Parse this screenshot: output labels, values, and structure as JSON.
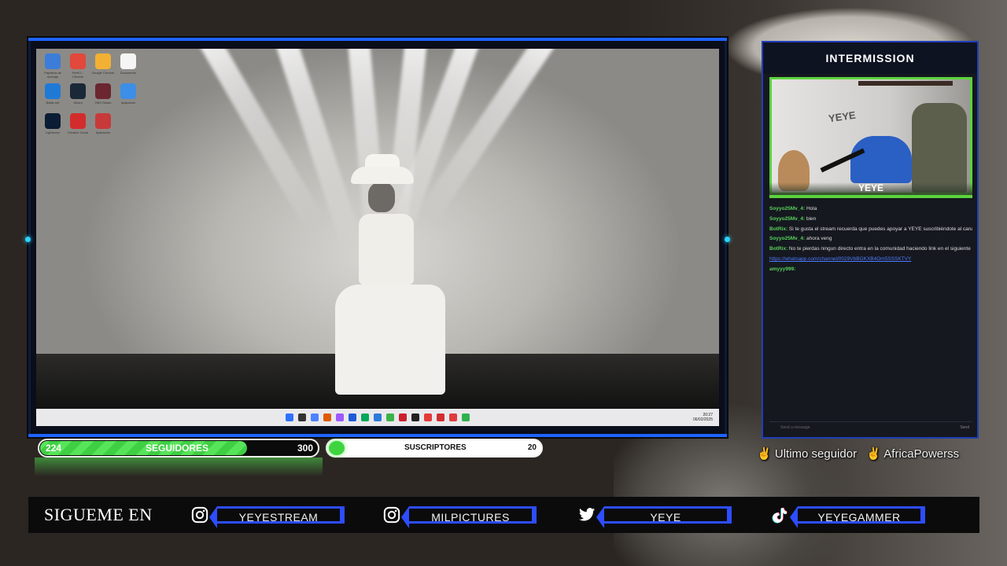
{
  "panel": {
    "title": "INTERMISSION",
    "cam_label": "YEYE",
    "cam_wall_text": "YEYE"
  },
  "chat": {
    "messages": [
      {
        "user": "Soyyo25Mv_4:",
        "text": "Hola"
      },
      {
        "user": "Soyyo25Mv_4:",
        "text": "bien"
      },
      {
        "user": "BotRix:",
        "text": "Si te gusta el stream recuerda que puedes apoyar a YEYE suscribiéndote al canal"
      },
      {
        "user": "Soyyo25Mv_4:",
        "text": "ahora veng"
      },
      {
        "user": "BotRix:",
        "text": "No te pierdas ningun directo entra en la comunidad haciendo link en el siguiente link"
      },
      {
        "user": "",
        "text": "https://whatsapp.com/channel/0029VbBGKXB4Om5SSSKTVY"
      },
      {
        "user": "amyyy999:",
        "text": ""
      }
    ],
    "input_placeholder": "Send a message",
    "send_label": "Send"
  },
  "followers_bar": {
    "current": "224",
    "label": "SEGUIDORES",
    "goal": "300",
    "progress": 0.747
  },
  "subs_bar": {
    "label": "SUSCRIPTORES",
    "goal": "20"
  },
  "last_follower": {
    "label": "Ultimo seguidor",
    "name": "AfricaPowerss"
  },
  "social": {
    "heading": "SIGUEME EN",
    "items": [
      {
        "icon": "instagram-icon",
        "handle": "YEYESTREAM"
      },
      {
        "icon": "instagram-icon",
        "handle": "MILPICTURES"
      },
      {
        "icon": "twitter-icon",
        "handle": "YEYE"
      },
      {
        "icon": "tiktok-icon",
        "handle": "YEYEGAMMER"
      }
    ]
  },
  "desktop": {
    "icons": [
      {
        "label": "Papelera de reciclaje",
        "color": "#3b7dd8"
      },
      {
        "label": "Perfil 1 - Chrome",
        "color": "#e2483b"
      },
      {
        "label": "Google Chrome",
        "color": "#f2b134"
      },
      {
        "label": "Documento",
        "color": "#f5f5f5"
      },
      {
        "label": "Battle.net",
        "color": "#1f7ad6"
      },
      {
        "label": "Steam",
        "color": "#1b2838"
      },
      {
        "label": "OBS Studio",
        "color": "#6b2630"
      },
      {
        "label": "Aplicación",
        "color": "#3d8ee6"
      },
      {
        "label": "Lightroom",
        "color": "#0b1c35"
      },
      {
        "label": "Creative Cloud",
        "color": "#d32c2c"
      },
      {
        "label": "Aplicación",
        "color": "#c83a3a"
      }
    ],
    "tray_time": "20:27",
    "tray_date": "06/02/2025",
    "taskbar_colors": [
      "#2f71ff",
      "#333",
      "#4b82ff",
      "#e05a00",
      "#9d58ff",
      "#1e5bd6",
      "#00a85a",
      "#2b7bd9",
      "#3bb34a",
      "#cc1f2d",
      "#222",
      "#e33b3b",
      "#d12f2f",
      "#e03c3c",
      "#2fb24b"
    ]
  },
  "colors": {
    "accent_blue": "#1e63ff",
    "accent_green": "#5bd33d"
  }
}
